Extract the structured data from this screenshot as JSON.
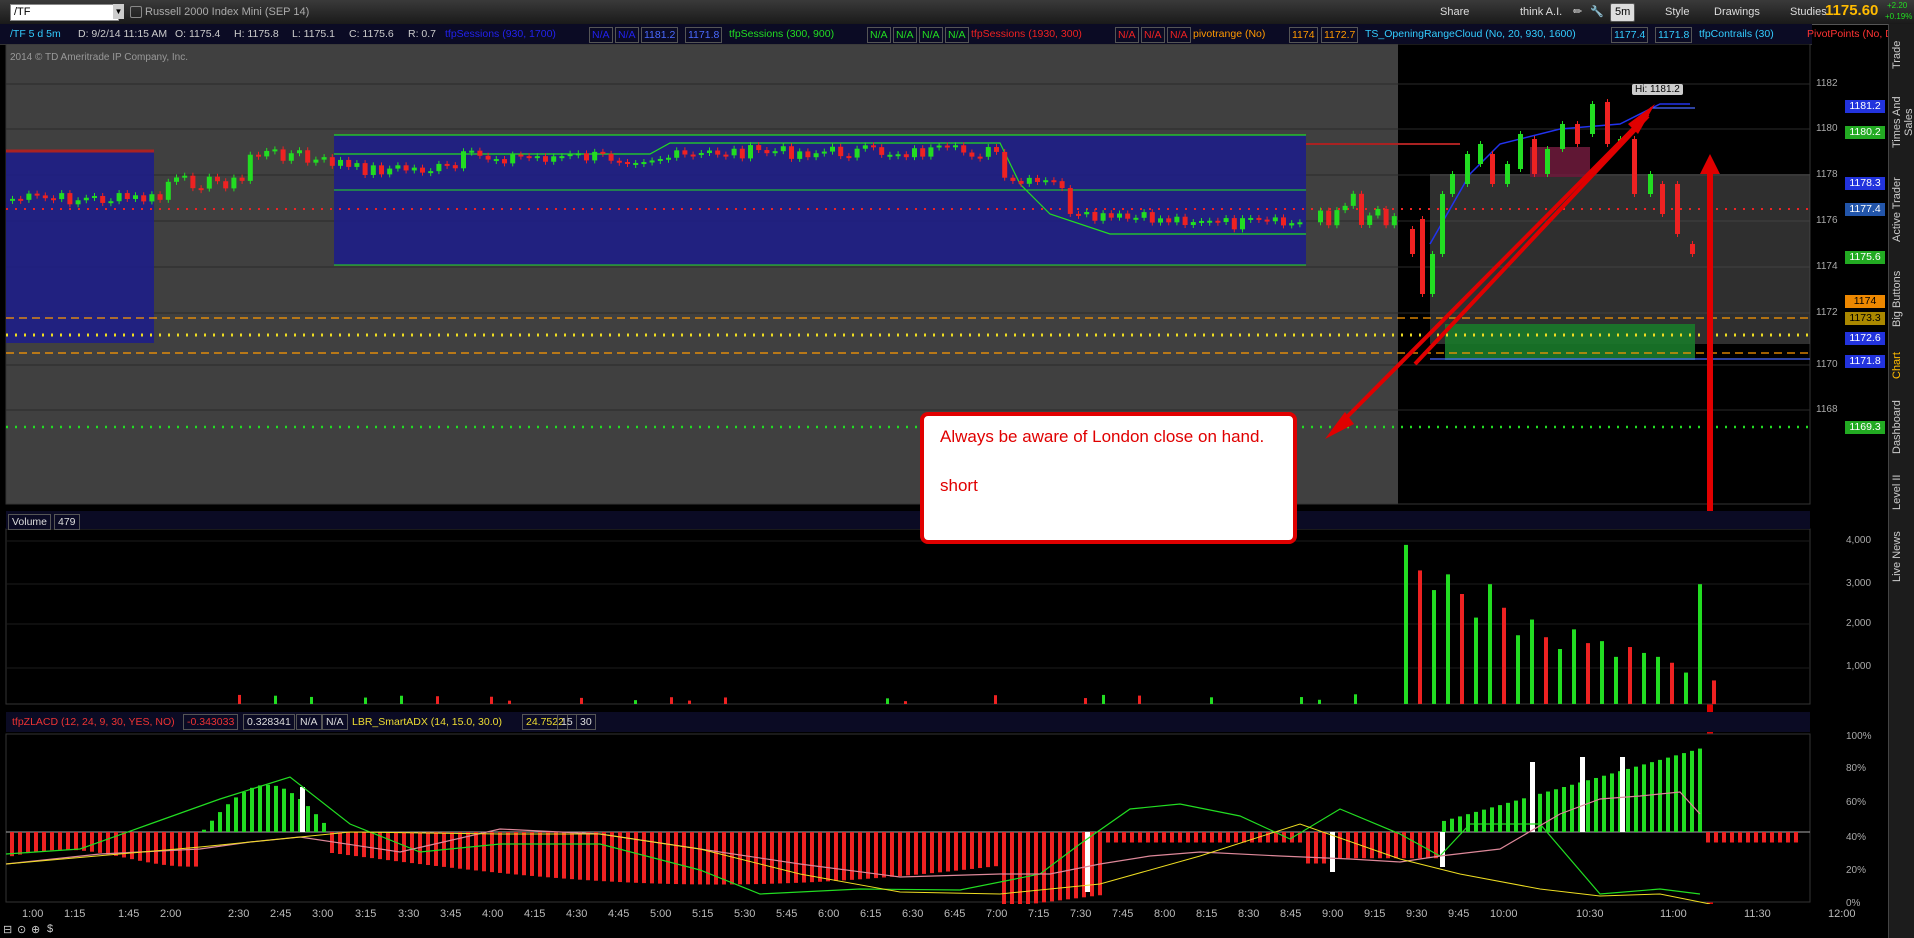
{
  "topbar": {
    "symbol": "/TF",
    "period": "/TF 5 d 5m",
    "instrument": "Russell 2000 Index Mini (SEP 14)",
    "datetime": "D: 9/2/14 11:15 AM",
    "open": "O: 1175.4",
    "high": "H: 1175.8",
    "low": "L: 1175.1",
    "close": "C: 1175.6",
    "range": "R: 0.7",
    "share": "Share",
    "think": "think A.I.",
    "timeframe": "5m",
    "style": "Style",
    "drawings": "Drawings",
    "studies": "Studies",
    "last_price": "1175.60",
    "change_top": "+2.20",
    "change_bot": "+0.19%"
  },
  "watermark": "2014 © TD Ameritrade IP Company, Inc.",
  "studies": [
    {
      "text": "tfpSessions (930, 1700)",
      "color": "#2222ee"
    },
    {
      "text": "N/A",
      "color": "#2222ee",
      "boxed": true
    },
    {
      "text": "N/A",
      "color": "#2222ee",
      "boxed": true
    },
    {
      "text": "1181.2",
      "color": "#4a6aff",
      "boxed": true
    },
    {
      "text": "1171.8",
      "color": "#4a6aff",
      "boxed": true
    },
    {
      "text": "tfpSessions (300, 900)",
      "color": "#22dd22"
    },
    {
      "text": "N/A",
      "color": "#22dd22",
      "boxed": true
    },
    {
      "text": "N/A",
      "color": "#22dd22",
      "boxed": true
    },
    {
      "text": "N/A",
      "color": "#22dd22",
      "boxed": true
    },
    {
      "text": "N/A",
      "color": "#22dd22",
      "boxed": true
    },
    {
      "text": "tfpSessions (1930, 300)",
      "color": "#ee2222"
    },
    {
      "text": "N/A",
      "color": "#ee2222",
      "boxed": true
    },
    {
      "text": "N/A",
      "color": "#ee2222",
      "boxed": true
    },
    {
      "text": "N/A",
      "color": "#ee2222",
      "boxed": true
    },
    {
      "text": "pivotrange (No)",
      "color": "#ff9900"
    },
    {
      "text": "1174",
      "color": "#ff9900",
      "boxed": true
    },
    {
      "text": "1172.7",
      "color": "#ff9900",
      "boxed": true
    },
    {
      "text": "TS_OpeningRangeCloud (No, 20, 930, 1600)",
      "color": "#33ccff"
    },
    {
      "text": "1177.4",
      "color": "#33ccff",
      "boxed": true
    },
    {
      "text": "1171.8",
      "color": "#33ccff",
      "boxed": true
    },
    {
      "text": "tfpContrails (30)",
      "color": "#33ccff"
    },
    {
      "text": "PivotPoints (No, DAY)",
      "color": "#ff3333"
    }
  ],
  "price_axis": [
    "1182",
    "1180",
    "1178",
    "1176",
    "1174",
    "1172",
    "1170",
    "1168"
  ],
  "price_labels": [
    {
      "text": "1181.2",
      "bg": "#2233dd"
    },
    {
      "text": "1180.2",
      "bg": "#22aa22"
    },
    {
      "text": "1178.3",
      "bg": "#2233dd"
    },
    {
      "text": "1177.4",
      "bg": "#2255aa"
    },
    {
      "text": "1175.6",
      "bg": "#22aa22"
    },
    {
      "text": "1174",
      "bg": "#ee8800"
    },
    {
      "text": "1173.3",
      "bg": "#aa8800"
    },
    {
      "text": "1172.6",
      "bg": "#2233dd"
    },
    {
      "text": "1171.8",
      "bg": "#2233dd"
    },
    {
      "text": "1169.3",
      "bg": "#22aa22"
    }
  ],
  "hi_label": "Hi: 1181.2",
  "callout": {
    "line1": "Always be aware of London close on hand.",
    "line2": "short"
  },
  "volume": {
    "label": "Volume",
    "value": "479",
    "axis": [
      "4,000",
      "3,000",
      "2,000",
      "1,000"
    ]
  },
  "lower": {
    "study1": "tfpZLACD (12, 24, 9, 30, YES, NO)",
    "v1": "-0.343033",
    "v2": "0.328341",
    "v3": "N/A",
    "v4": "N/A",
    "study2": "LBR_SmartADX (14, 15.0, 30.0)",
    "v5": "24.7522",
    "v6": "15",
    "v7": "30",
    "axis": [
      "100%",
      "80%",
      "60%",
      "40%",
      "20%",
      "0%"
    ]
  },
  "time_axis": [
    "1:00",
    "1:15",
    "1:45",
    "2:00",
    "2:30",
    "2:45",
    "3:00",
    "3:15",
    "3:30",
    "3:45",
    "4:00",
    "4:15",
    "4:30",
    "4:45",
    "5:00",
    "5:15",
    "5:30",
    "5:45",
    "6:00",
    "6:15",
    "6:30",
    "6:45",
    "7:00",
    "7:15",
    "7:30",
    "7:45",
    "8:00",
    "8:15",
    "8:30",
    "8:45",
    "9:00",
    "9:15",
    "9:30",
    "9:45",
    "10:00",
    "10:30",
    "11:00",
    "11:30",
    "12:00"
  ],
  "right_tabs": [
    "Trade",
    "Times And Sales",
    "Active Trader",
    "Big Buttons",
    "Chart",
    "Dashboard",
    "Level II",
    "Live News"
  ],
  "colors": {
    "up": "#22dd22",
    "down": "#ee2222",
    "accent": "#e00000"
  }
}
